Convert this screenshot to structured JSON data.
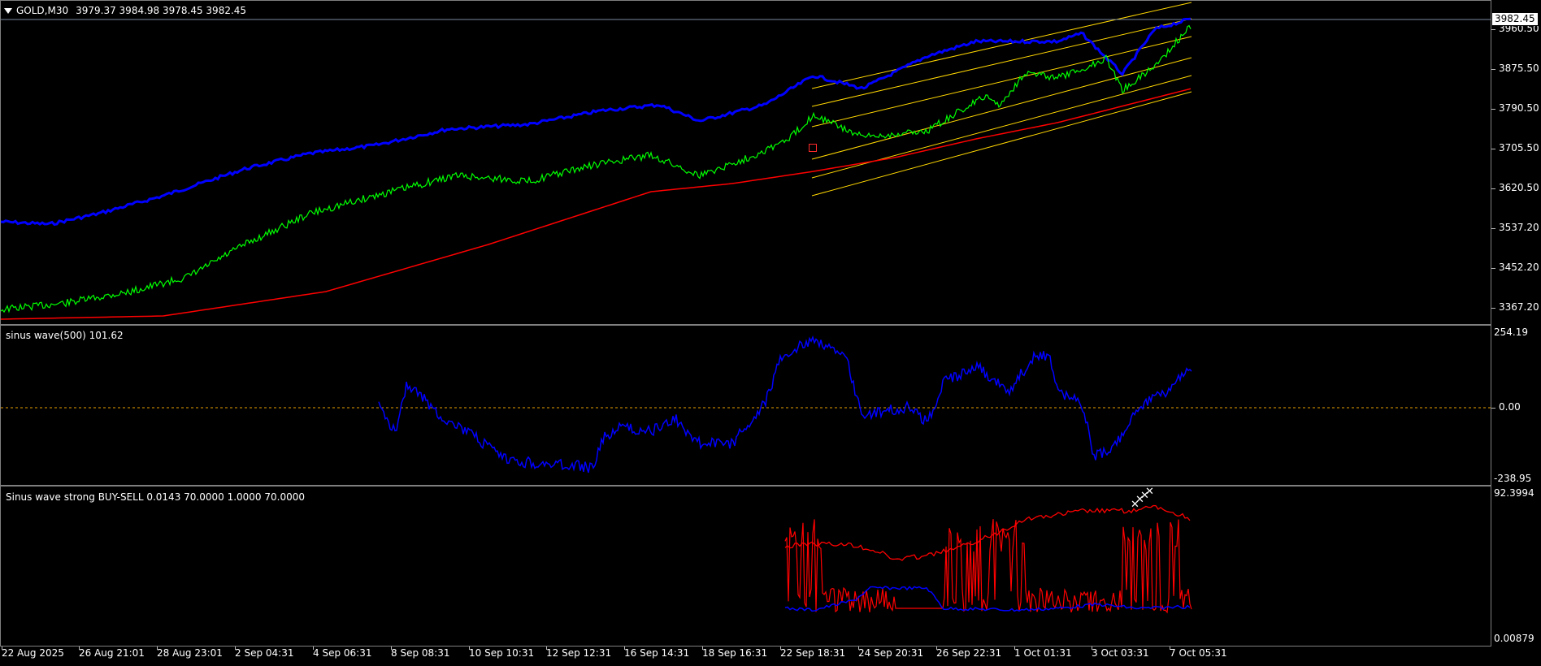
{
  "chart_header": {
    "menu_icon": "triangle-down-icon",
    "symbol": "GOLD,M30",
    "ohlc": "3979.37 3984.98 3978.45 3982.45"
  },
  "main_scale": {
    "last_price": "3982.45",
    "labels": [
      "3960.50",
      "3875.50",
      "3790.50",
      "3705.50",
      "3620.50",
      "3537.20",
      "3452.20",
      "3367.20"
    ]
  },
  "indicator1": {
    "title": "sinus wave(500) 101.62",
    "scale": [
      "254.19",
      "0.00",
      "-238.95"
    ]
  },
  "indicator2": {
    "title": "Sinus wave strong BUY-SELL 0.0143 70.0000 1.0000 70.0000",
    "scale_top": "92.3994",
    "scale_bottom": "0.00879"
  },
  "time_axis": [
    "22 Aug 2025",
    "26 Aug 21:01",
    "28 Aug 23:01",
    "2 Sep 04:31",
    "4 Sep 06:31",
    "8 Sep 08:31",
    "10 Sep 10:31",
    "12 Sep 12:31",
    "16 Sep 14:31",
    "18 Sep 16:31",
    "22 Sep 18:31",
    "24 Sep 20:31",
    "26 Sep 22:31",
    "1 Oct 01:31",
    "3 Oct 03:31",
    "7 Oct 05:31"
  ],
  "colors": {
    "background": "#000000",
    "upper_band": "#0000ff",
    "price_line": "#00ff00",
    "moving_average": "#ff0000",
    "channel": "#ffd700",
    "sinus_wave": "#0000ff",
    "buy_sell_strong": "#ff0000",
    "buy_sell_weak": "#0000ff",
    "signal_marker": "#ffffff"
  }
}
